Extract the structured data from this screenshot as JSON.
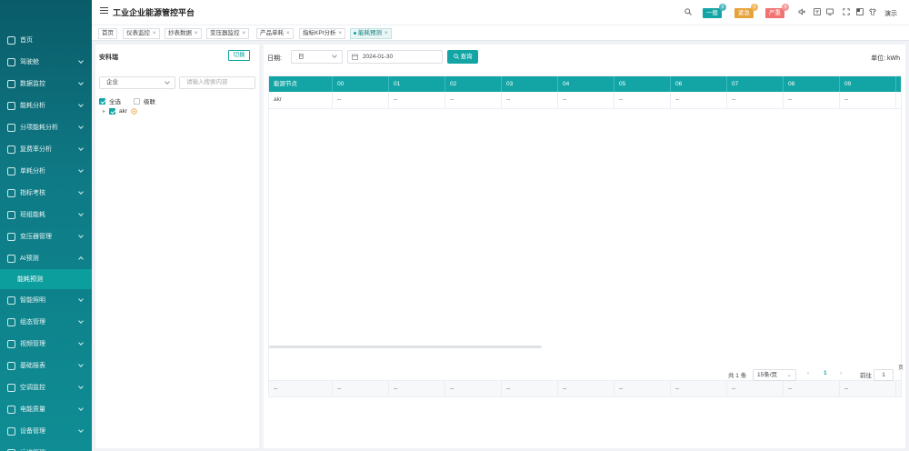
{
  "header": {
    "title": "工业企业能源管控平台",
    "alerts": [
      {
        "label": "一般",
        "count": "0",
        "color": "#13a5a5"
      },
      {
        "label": "紧急",
        "count": "0",
        "color": "#e6a23c"
      },
      {
        "label": "严重",
        "count": "4",
        "color": "#f07272"
      }
    ],
    "user": "演示"
  },
  "sidebar": {
    "items": [
      {
        "label": "首页",
        "icon": "home-icon",
        "chev": false
      },
      {
        "label": "驾驶舱",
        "icon": "dashboard-icon",
        "chev": true
      },
      {
        "label": "数据监控",
        "icon": "monitor-icon",
        "chev": true
      },
      {
        "label": "能耗分析",
        "icon": "chart-icon",
        "chev": true
      },
      {
        "label": "分项能耗分析",
        "icon": "trend-icon",
        "chev": true
      },
      {
        "label": "复费率分析",
        "icon": "rate-icon",
        "chev": true
      },
      {
        "label": "单耗分析",
        "icon": "unit-icon",
        "chev": true
      },
      {
        "label": "指标考核",
        "icon": "target-icon",
        "chev": true
      },
      {
        "label": "班组能耗",
        "icon": "team-icon",
        "chev": true
      },
      {
        "label": "变压器管理",
        "icon": "transformer-icon",
        "chev": true
      },
      {
        "label": "AI预测",
        "icon": "ai-icon",
        "chev": true,
        "open": true
      },
      {
        "label": "智能照明",
        "icon": "light-icon",
        "chev": true
      },
      {
        "label": "组态管理",
        "icon": "config-icon",
        "chev": true
      },
      {
        "label": "视频管理",
        "icon": "video-icon",
        "chev": true
      },
      {
        "label": "基础报表",
        "icon": "report-icon",
        "chev": true
      },
      {
        "label": "空调监控",
        "icon": "ac-icon",
        "chev": true
      },
      {
        "label": "电能质量",
        "icon": "power-icon",
        "chev": true
      },
      {
        "label": "设备管理",
        "icon": "device-icon",
        "chev": true
      },
      {
        "label": "运维管理",
        "icon": "ops-icon",
        "chev": true
      }
    ],
    "sub_item": "能耗预测"
  },
  "tabs": [
    {
      "label": "首页",
      "closable": false
    },
    {
      "label": "仪表监控",
      "closable": true
    },
    {
      "label": "抄表数据",
      "closable": true
    },
    {
      "label": "变压器监控",
      "closable": true
    },
    {
      "label": "产品单耗",
      "closable": true
    },
    {
      "label": "指标KPI分析",
      "closable": true
    },
    {
      "label": "能耗预测",
      "closable": true,
      "active": true
    }
  ],
  "left_panel": {
    "title": "安科瑞",
    "switch_label": "切换",
    "scope_select": "企业",
    "search_placeholder": "请输入搜索内容",
    "select_all_label": "全选",
    "cascade_label": "级联",
    "tree_node": "akr"
  },
  "query": {
    "date_label": "日期:",
    "period_select": "日",
    "date_value": "2024-01-30",
    "query_label": "查询",
    "unit_label": "单位: kWh"
  },
  "table": {
    "columns": [
      "能源节点",
      "00",
      "01",
      "02",
      "03",
      "04",
      "05",
      "06",
      "07",
      "08",
      "09",
      ""
    ],
    "rows": [
      [
        "akr",
        "--",
        "--",
        "--",
        "--",
        "--",
        "--",
        "--",
        "--",
        "--",
        "--",
        ""
      ]
    ],
    "footer": [
      "--",
      "--",
      "--",
      "--",
      "--",
      "--",
      "--",
      "--",
      "--",
      "--",
      "--",
      ""
    ]
  },
  "pagination": {
    "total": "共 1 条",
    "page_size": "15条/页",
    "current_page": "1",
    "goto_label": "前往",
    "goto_value": "1",
    "page_suffix": "页"
  }
}
